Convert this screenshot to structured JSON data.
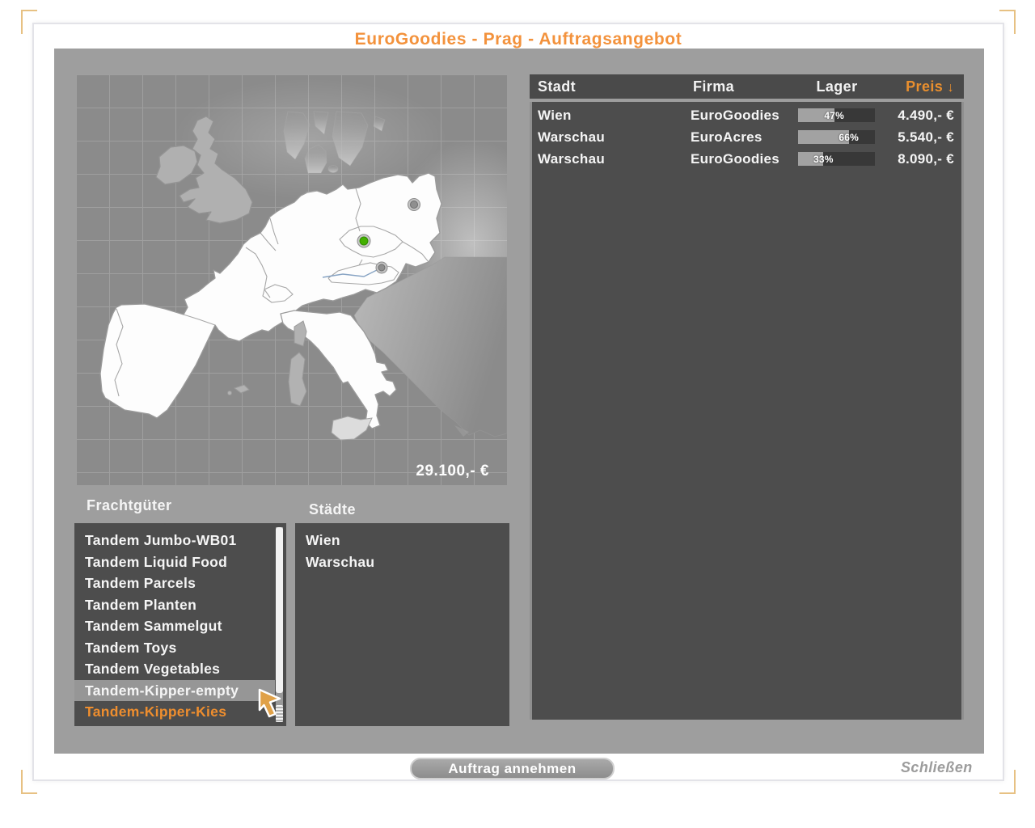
{
  "window": {
    "title": "EuroGoodies - Prag - Auftragsangebot"
  },
  "map": {
    "total_price": "29.100,- €",
    "markers": [
      {
        "city": "Prag",
        "color": "#43b000",
        "type": "origin-marker"
      },
      {
        "city": "Warschau",
        "color": "#8f8f8f",
        "type": "city-marker"
      },
      {
        "city": "Wien",
        "color": "#8f8f8f",
        "type": "city-marker"
      }
    ]
  },
  "offers": {
    "columns": {
      "stadt": "Stadt",
      "firma": "Firma",
      "lager": "Lager",
      "preis": "Preis",
      "sort_arrow": "↓"
    },
    "rows": [
      {
        "stadt": "Wien",
        "firma": "EuroGoodies",
        "lager_pct": 47,
        "lager_label": "47%",
        "preis": "4.490,- €"
      },
      {
        "stadt": "Warschau",
        "firma": "EuroAcres",
        "lager_pct": 66,
        "lager_label": "66%",
        "preis": "5.540,- €"
      },
      {
        "stadt": "Warschau",
        "firma": "EuroGoodies",
        "lager_pct": 33,
        "lager_label": "33%",
        "preis": "8.090,- €"
      }
    ]
  },
  "freight": {
    "label": "Frachtgüter",
    "items": [
      {
        "label": "Tandem Jumbo-WB01",
        "state": "normal"
      },
      {
        "label": "Tandem Liquid Food",
        "state": "normal"
      },
      {
        "label": "Tandem Parcels",
        "state": "normal"
      },
      {
        "label": "Tandem Planten",
        "state": "normal"
      },
      {
        "label": "Tandem Sammelgut",
        "state": "normal"
      },
      {
        "label": "Tandem Toys",
        "state": "normal"
      },
      {
        "label": "Tandem Vegetables",
        "state": "normal"
      },
      {
        "label": "Tandem-Kipper-empty",
        "state": "hover"
      },
      {
        "label": "Tandem-Kipper-Kies",
        "state": "selected"
      }
    ]
  },
  "cities": {
    "label": "Städte",
    "items": [
      {
        "label": "Wien"
      },
      {
        "label": "Warschau"
      }
    ]
  },
  "footer": {
    "accept_button": "Auftrag annehmen",
    "close_button": "Schließen"
  },
  "colors": {
    "accent_orange": "#f3923c",
    "selected_orange": "#ef8e2e",
    "marker_green": "#43b000",
    "panel_gray": "#9e9e9e",
    "box_dark": "#4d4d4d",
    "bracket_tan": "#e7c183"
  }
}
